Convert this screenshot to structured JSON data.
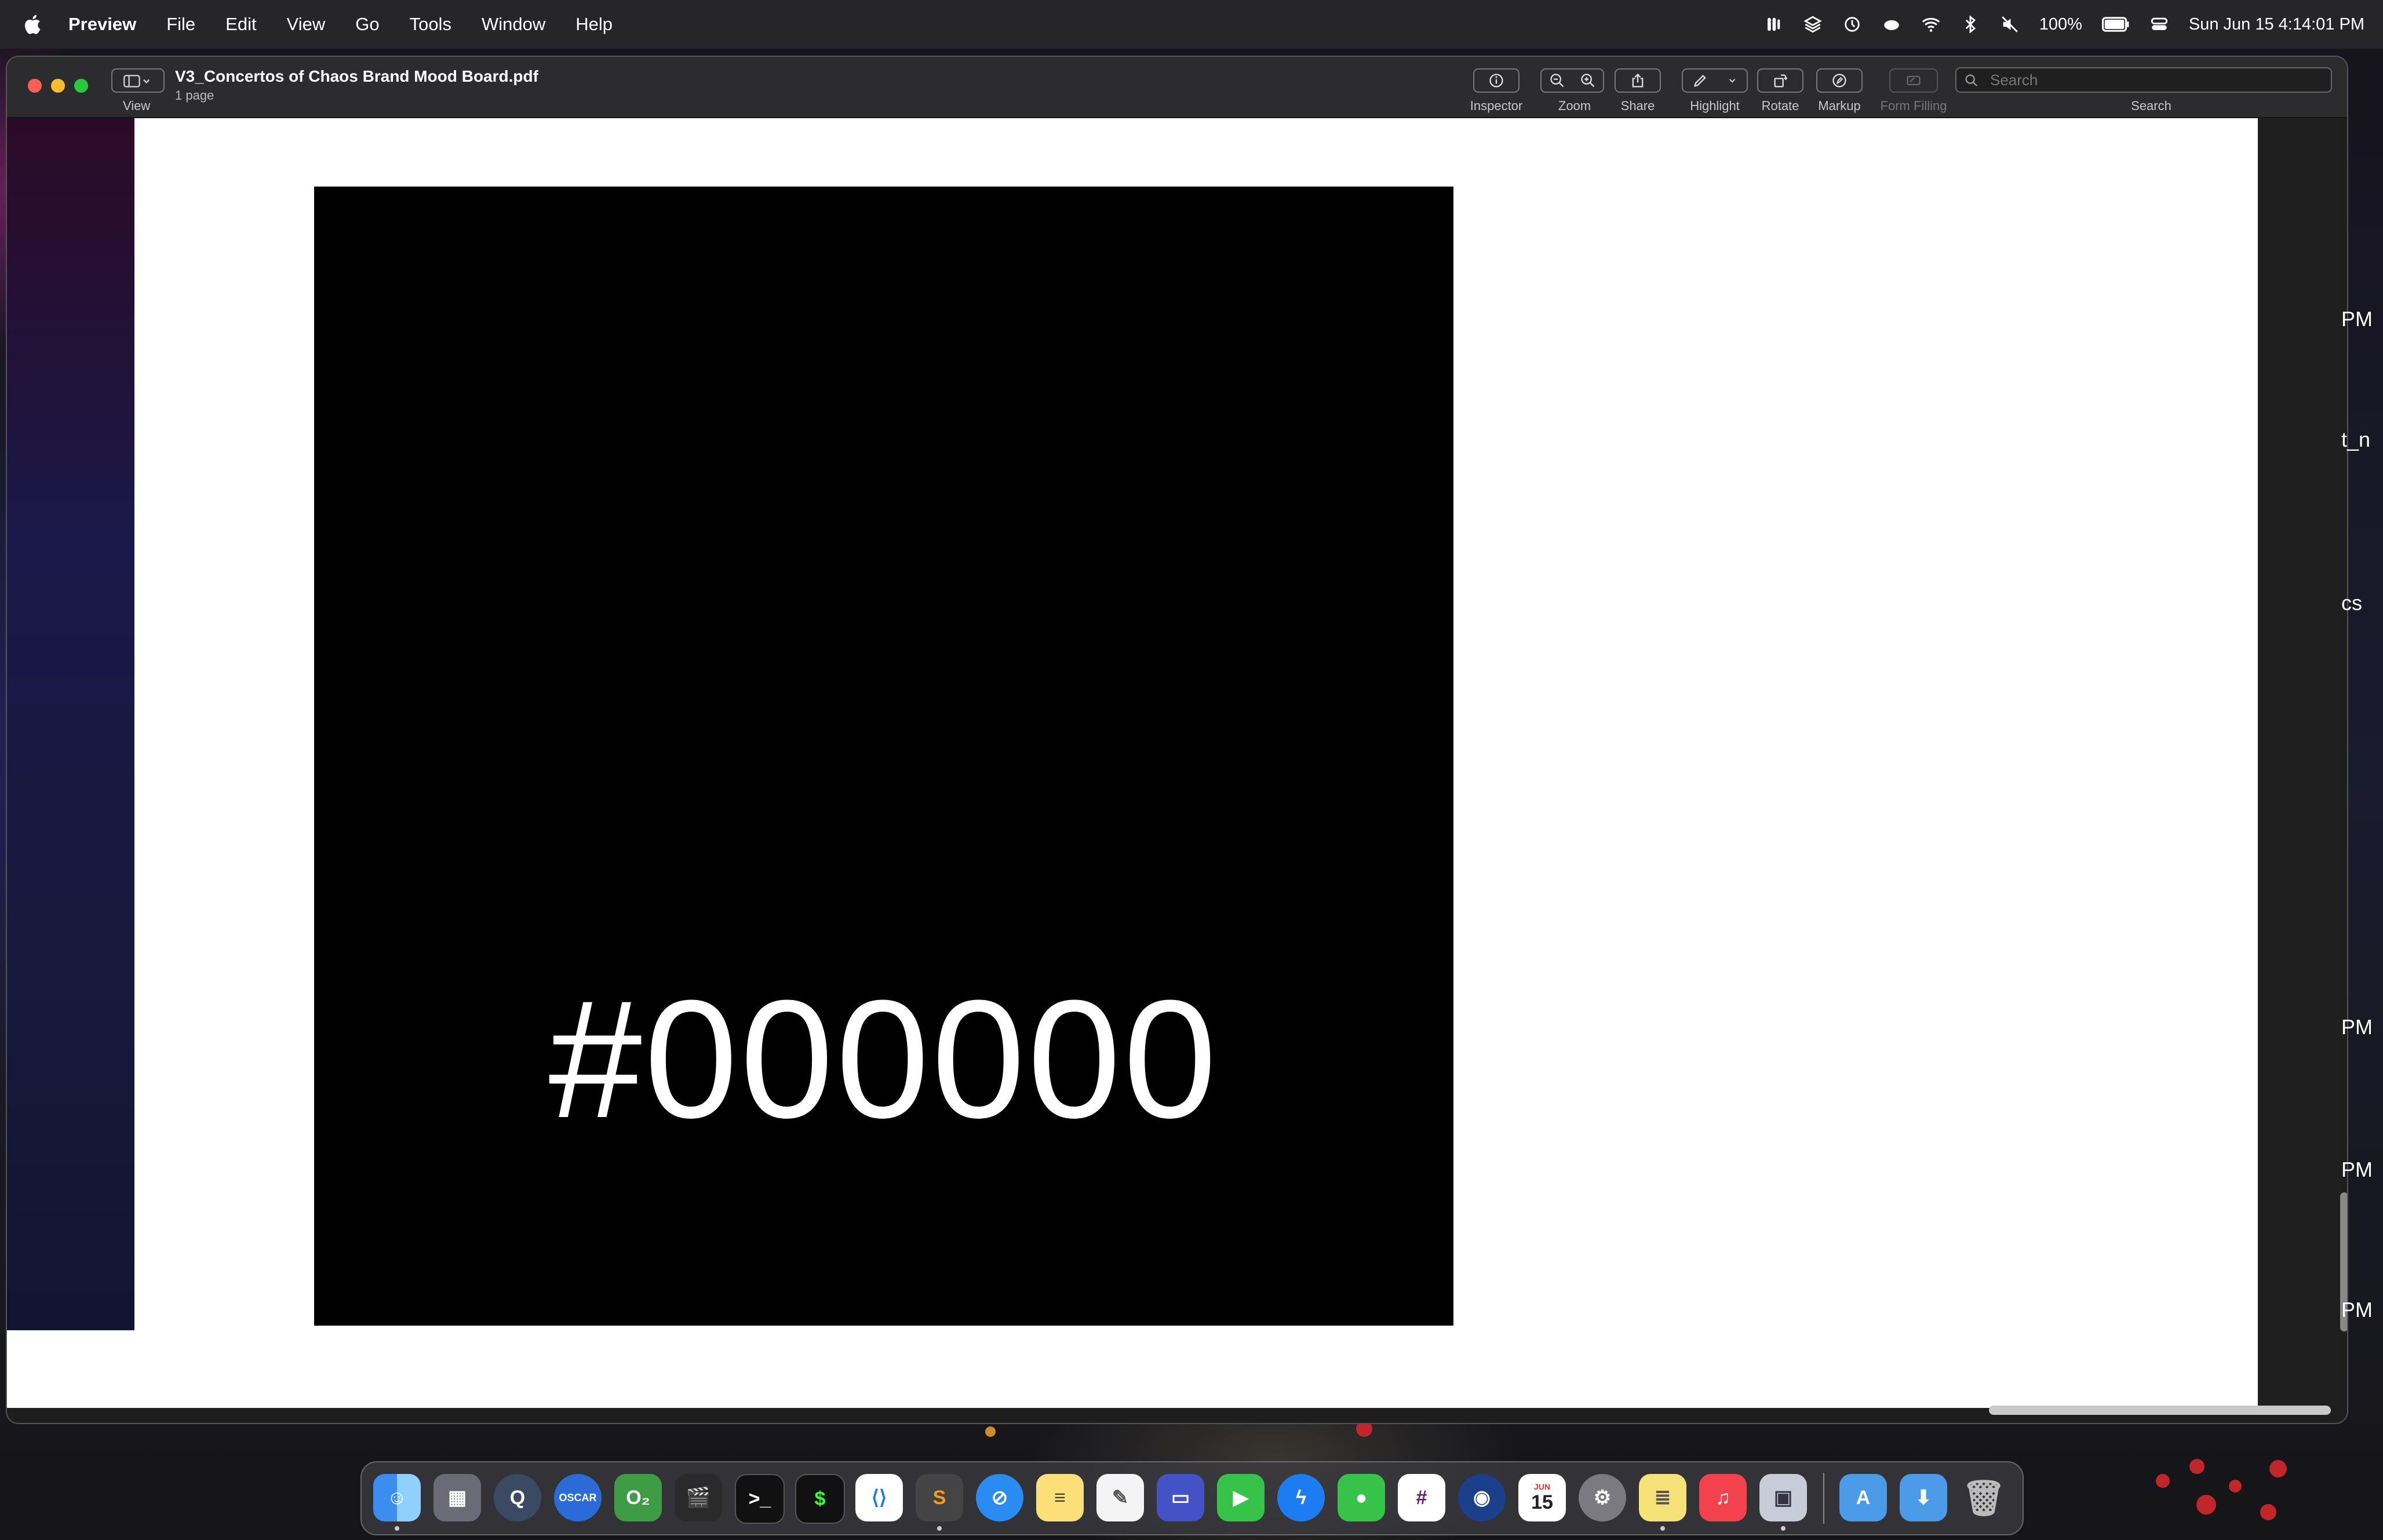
{
  "menubar": {
    "app_name": "Preview",
    "menus": [
      "File",
      "Edit",
      "View",
      "Go",
      "Tools",
      "Window",
      "Help"
    ],
    "battery": "100%",
    "datetime": "Sun Jun 15  4:14:01 PM"
  },
  "window": {
    "title": "V3_Concertos of Chaos Brand Mood Board.pdf",
    "subtitle": "1 page",
    "toolbar": {
      "view_label": "View",
      "inspector_label": "Inspector",
      "zoom_label": "Zoom",
      "share_label": "Share",
      "highlight_label": "Highlight",
      "rotate_label": "Rotate",
      "markup_label": "Markup",
      "form_filling_label": "Form Filling",
      "search_label": "Search",
      "search_placeholder": "Search"
    }
  },
  "document": {
    "swatch_color": "#000000",
    "swatch_text": "#000000"
  },
  "background_fragments": [
    "PM",
    "t_n",
    "cs",
    "PM",
    "PM",
    "PM"
  ],
  "dock": {
    "calendar_month": "JUN",
    "calendar_day": "15",
    "apps": [
      "Finder",
      "Launchpad",
      "QuickTime Player",
      "Oscar",
      "O2",
      "Final Cut Pro",
      "Terminal",
      "iTerm",
      "Visual Studio Code",
      "Sublime Text",
      "Safari",
      "Notes",
      "TextEdit",
      "Screens",
      "FaceTime",
      "Messenger",
      "Messages",
      "Slack",
      "Firefox",
      "Calendar",
      "System Settings",
      "Stickies",
      "Music",
      "Preview",
      "Applications",
      "Downloads",
      "Trash"
    ]
  }
}
